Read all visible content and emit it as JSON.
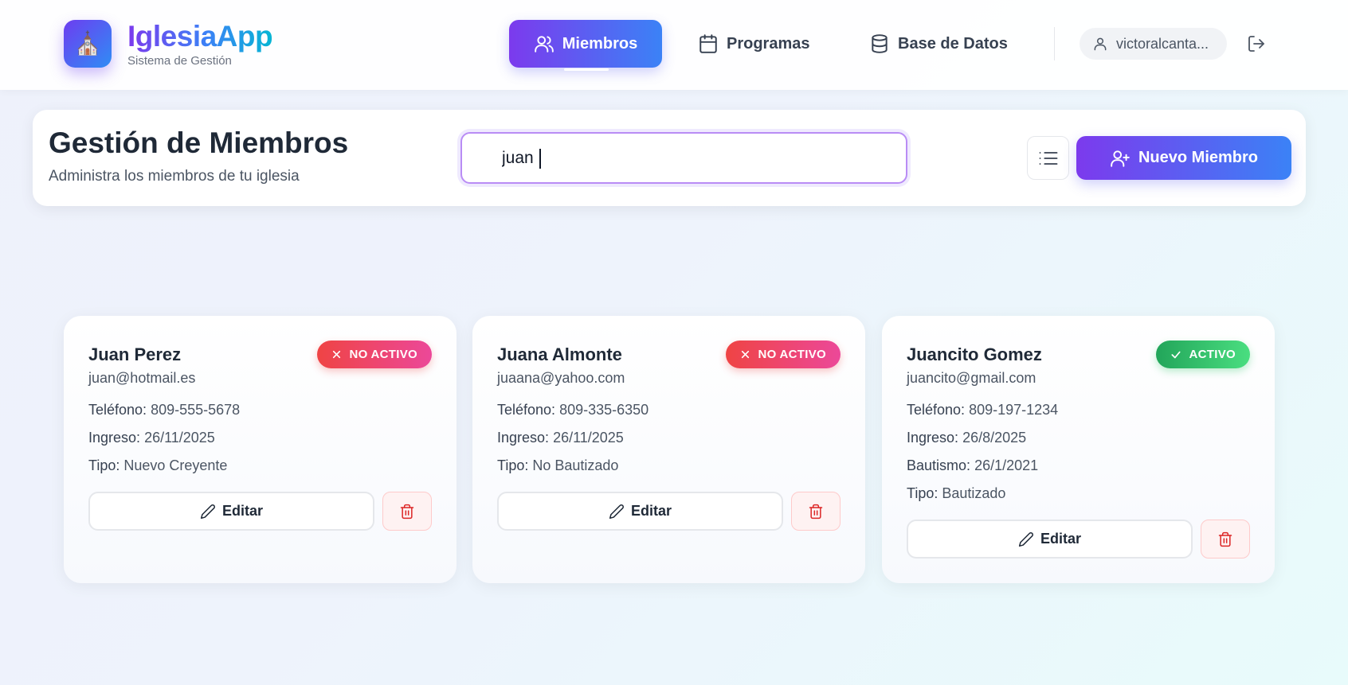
{
  "brand": {
    "title": "IglesiaApp",
    "subtitle": "Sistema de Gestión",
    "logo_icon": "church-emoji",
    "logo_glyph": "⛪"
  },
  "nav": {
    "items": [
      {
        "label": "Miembros",
        "icon": "users-icon",
        "active": true
      },
      {
        "label": "Programas",
        "icon": "calendar-icon",
        "active": false
      },
      {
        "label": "Base de Datos",
        "icon": "database-icon",
        "active": false
      }
    ],
    "user": "victoralcanta..."
  },
  "toolbar": {
    "title": "Gestión de Miembros",
    "subtitle": "Administra los miembros de tu iglesia",
    "search_value": "juan",
    "new_button": "Nuevo Miembro"
  },
  "members": [
    {
      "name": "Juan Perez",
      "email": "juan@hotmail.es",
      "status": "NO ACTIVO",
      "fields": [
        {
          "label": "Teléfono:",
          "value": "809-555-5678"
        },
        {
          "label": "Ingreso:",
          "value": "26/11/2025"
        },
        {
          "label": "Tipo:",
          "value": "Nuevo Creyente"
        }
      ],
      "edit_label": "Editar"
    },
    {
      "name": "Juana Almonte",
      "email": "juaana@yahoo.com",
      "status": "NO ACTIVO",
      "fields": [
        {
          "label": "Teléfono:",
          "value": "809-335-6350"
        },
        {
          "label": "Ingreso:",
          "value": "26/11/2025"
        },
        {
          "label": "Tipo:",
          "value": "No Bautizado"
        }
      ],
      "edit_label": "Editar"
    },
    {
      "name": "Juancito Gomez",
      "email": "juancito@gmail.com",
      "status": "ACTIVO",
      "fields": [
        {
          "label": "Teléfono:",
          "value": "809-197-1234"
        },
        {
          "label": "Ingreso:",
          "value": "26/8/2025"
        },
        {
          "label": "Bautismo:",
          "value": "26/1/2021"
        },
        {
          "label": "Tipo:",
          "value": "Bautizado"
        }
      ],
      "edit_label": "Editar"
    }
  ],
  "colors": {
    "accent_start": "#7c3aed",
    "accent_end": "#3b82f6",
    "inactive": "#ef4444",
    "active": "#22c55e",
    "danger": "#dc2626"
  }
}
